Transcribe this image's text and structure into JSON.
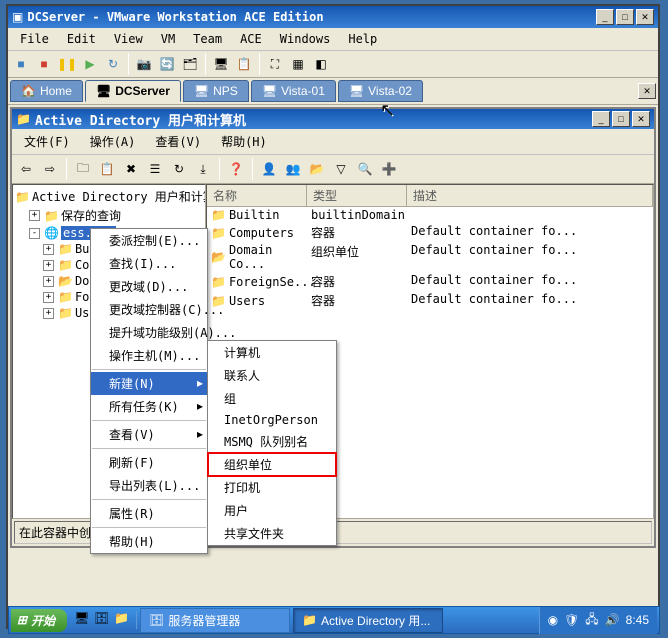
{
  "window": {
    "title": "DCServer - VMware Workstation ACE Edition",
    "menu": [
      "File",
      "Edit",
      "View",
      "VM",
      "Team",
      "ACE",
      "Windows",
      "Help"
    ]
  },
  "tabs": {
    "home": "Home",
    "items": [
      "DCServer",
      "NPS",
      "Vista-01",
      "Vista-02"
    ],
    "active": 0
  },
  "inner": {
    "title": "Active Directory 用户和计算机",
    "menu": [
      "文件(F)",
      "操作(A)",
      "查看(V)",
      "帮助(H)"
    ]
  },
  "tree": {
    "root": "Active Directory 用户和计算机",
    "saved": "保存的查询",
    "domain": "ess.com",
    "children": [
      "Bu",
      "Co",
      "Do",
      "Fo",
      "Us"
    ]
  },
  "columns": {
    "name": "名称",
    "type": "类型",
    "desc": "描述"
  },
  "rows": [
    {
      "name": "Builtin",
      "type": "builtinDomain",
      "desc": ""
    },
    {
      "name": "Computers",
      "type": "容器",
      "desc": "Default container fo..."
    },
    {
      "name": "Domain Co...",
      "type": "组织单位",
      "desc": "Default container fo..."
    },
    {
      "name": "ForeignSe...",
      "type": "容器",
      "desc": "Default container fo..."
    },
    {
      "name": "Users",
      "type": "容器",
      "desc": "Default container fo..."
    }
  ],
  "ctx": {
    "items": [
      "委派控制(E)...",
      "查找(I)...",
      "更改域(D)...",
      "更改域控制器(C)...",
      "提升域功能级别(A)...",
      "操作主机(M)..."
    ],
    "new_label": "新建(N)",
    "tasks": "所有任务(K)",
    "view": "查看(V)",
    "refresh": "刷新(F)",
    "export": "导出列表(L)...",
    "props": "属性(R)",
    "help": "帮助(H)"
  },
  "sub": [
    "计算机",
    "联系人",
    "组",
    "InetOrgPerson",
    "MSMQ 队列别名",
    "组织单位",
    "打印机",
    "用户",
    "共享文件夹"
  ],
  "status": "在此容器中创建一新的项目。",
  "taskbar": {
    "start": "开始",
    "tasks": [
      "服务器管理器",
      "Active Directory 用..."
    ],
    "time": "8:45"
  }
}
